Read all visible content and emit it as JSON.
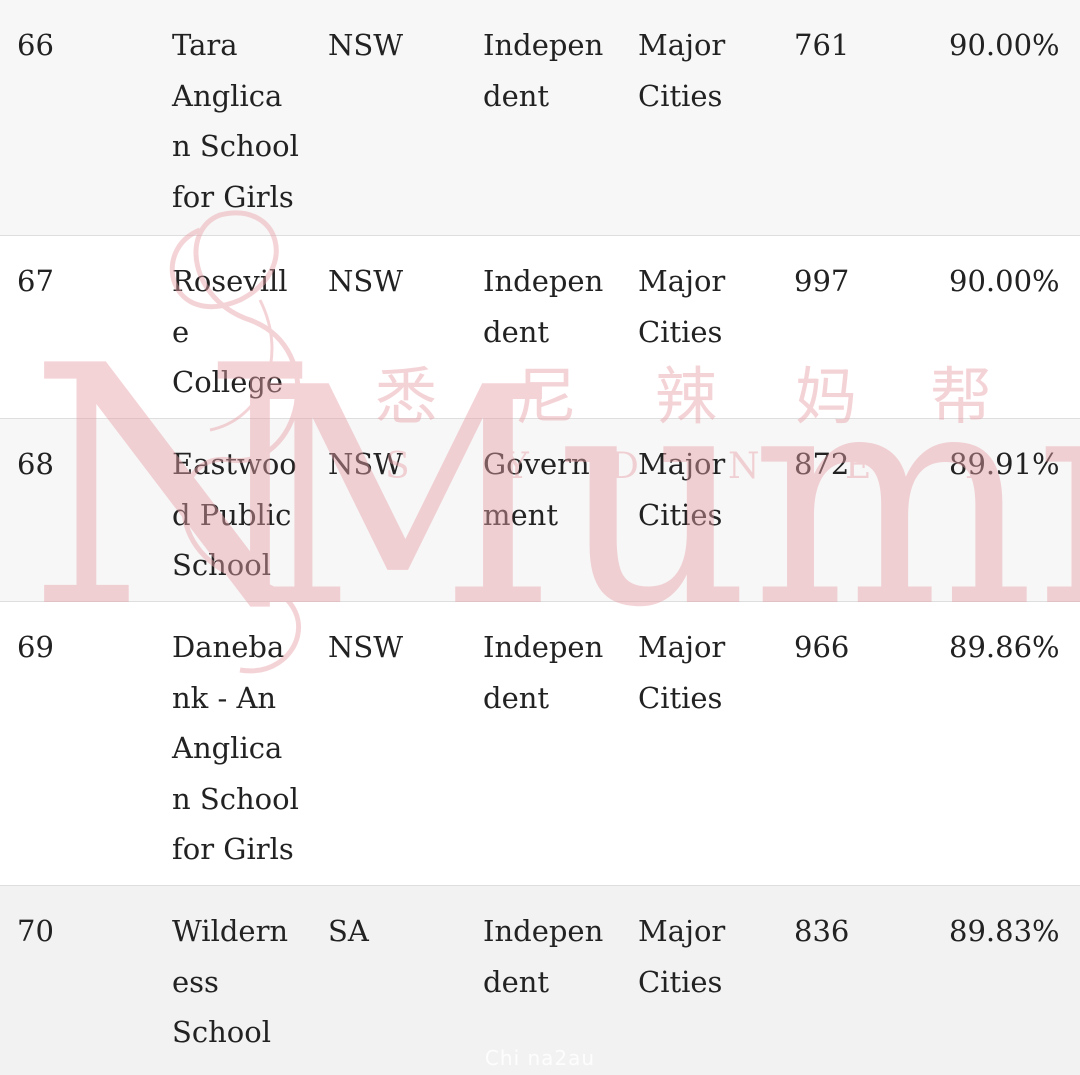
{
  "rows": [
    {
      "rank": "66",
      "name_lines": [
        "Tara",
        "Anglica",
        "n School",
        "for Girls"
      ],
      "state": "NSW",
      "sector_lines": [
        "Indepen",
        "dent"
      ],
      "region_lines": [
        "Major",
        "Cities"
      ],
      "enrolment": "761",
      "percent": "90.00%"
    },
    {
      "rank": "67",
      "name_lines": [
        "Rosevill",
        "e",
        "College"
      ],
      "state": "NSW",
      "sector_lines": [
        "Indepen",
        "dent"
      ],
      "region_lines": [
        "Major",
        "Cities"
      ],
      "enrolment": "997",
      "percent": "90.00%"
    },
    {
      "rank": "68",
      "name_lines": [
        "Eastwoo",
        "d Public",
        "School"
      ],
      "state": "NSW",
      "sector_lines": [
        "Govern",
        "ment"
      ],
      "region_lines": [
        "Major",
        "Cities"
      ],
      "enrolment": "872",
      "percent": "89.91%"
    },
    {
      "rank": "69",
      "name_lines": [
        "Daneba",
        "nk - An",
        "Anglica",
        "n School",
        "for Girls"
      ],
      "state": "NSW",
      "sector_lines": [
        "Indepen",
        "dent"
      ],
      "region_lines": [
        "Major",
        "Cities"
      ],
      "enrolment": "966",
      "percent": "89.86%"
    },
    {
      "rank": "70",
      "name_lines": [
        "Wildern",
        "ess",
        "School"
      ],
      "state": "SA",
      "sector_lines": [
        "Indepen",
        "dent"
      ],
      "region_lines": [
        "Major",
        "Cities"
      ],
      "enrolment": "836",
      "percent": "89.83%"
    }
  ],
  "watermark": {
    "word": "Mummy",
    "chinese": [
      "悉",
      "尼",
      "辣",
      "妈",
      "帮"
    ],
    "sydney_letters": [
      "S",
      "Y",
      "D",
      "N",
      "E",
      "Y"
    ],
    "color": "#e8a0a8"
  },
  "footer_watermark": "Chi na2au"
}
